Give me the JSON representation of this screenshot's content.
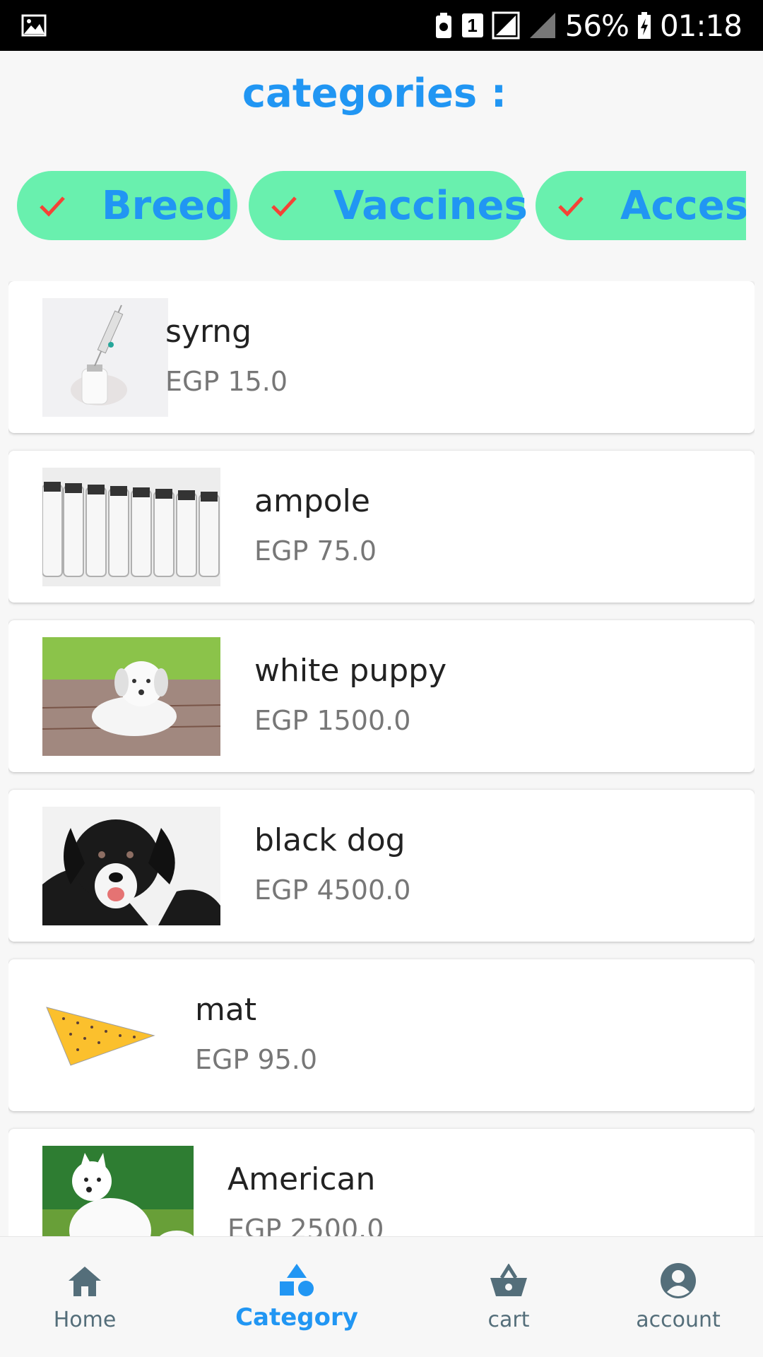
{
  "status_bar": {
    "battery": "56%",
    "time": "01:18",
    "sim_badge": "1"
  },
  "page": {
    "title": "categories :"
  },
  "chips": [
    {
      "label": "Breed"
    },
    {
      "label": "Vaccines"
    },
    {
      "label": "Accessories"
    }
  ],
  "items": [
    {
      "name": "syrng",
      "price": "EGP 15.0"
    },
    {
      "name": "ampole",
      "price": "EGP 75.0"
    },
    {
      "name": "white puppy",
      "price": "EGP 1500.0"
    },
    {
      "name": "black dog",
      "price": "EGP 4500.0"
    },
    {
      "name": "mat",
      "price": "EGP 95.0"
    },
    {
      "name": "American",
      "price": "EGP 2500.0"
    }
  ],
  "bottom_nav": {
    "items": [
      {
        "label": "Home",
        "icon": "home-icon",
        "active": false
      },
      {
        "label": "Category",
        "icon": "category-icon",
        "active": true
      },
      {
        "label": "cart",
        "icon": "basket-icon",
        "active": false
      },
      {
        "label": "account",
        "icon": "account-icon",
        "active": false
      }
    ]
  },
  "colors": {
    "accent": "#2196f3",
    "chip_bg": "#69f0ae",
    "check": "#f44336",
    "nav_inactive": "#546e7a"
  }
}
